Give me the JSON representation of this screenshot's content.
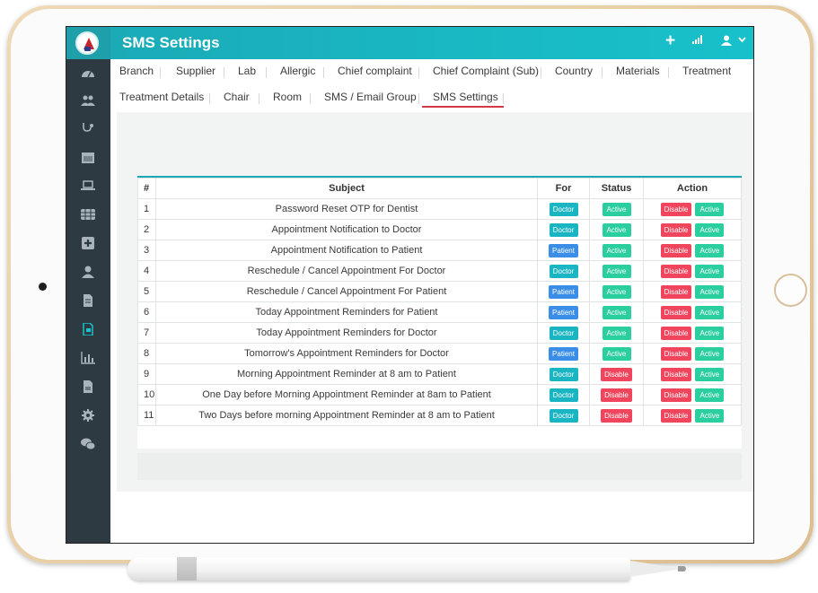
{
  "header": {
    "title": "SMS Settings"
  },
  "tabs": [
    "Branch",
    "Supplier",
    "Lab",
    "Allergic",
    "Chief complaint",
    "Chief Complaint (Sub)",
    "Country",
    "Materials",
    "Treatment",
    "Treatment Details",
    "Chair",
    "Room",
    "SMS / Email Group",
    "SMS Settings"
  ],
  "active_tab": "SMS Settings",
  "table": {
    "columns": [
      "#",
      "Subject",
      "For",
      "Status",
      "Action"
    ],
    "rows": [
      {
        "num": "1",
        "subject": "Password Reset OTP for Dentist",
        "for": "Doctor",
        "status": "Active",
        "action1": "Disable",
        "action2": "Active"
      },
      {
        "num": "2",
        "subject": "Appointment Notification to Doctor",
        "for": "Doctor",
        "status": "Active",
        "action1": "Disable",
        "action2": "Active"
      },
      {
        "num": "3",
        "subject": "Appointment Notification to Patient",
        "for": "Patient",
        "status": "Active",
        "action1": "Disable",
        "action2": "Active"
      },
      {
        "num": "4",
        "subject": "Reschedule / Cancel Appointment For Doctor",
        "for": "Doctor",
        "status": "Active",
        "action1": "Disable",
        "action2": "Active"
      },
      {
        "num": "5",
        "subject": "Reschedule / Cancel Appointment For Patient",
        "for": "Patient",
        "status": "Active",
        "action1": "Disable",
        "action2": "Active"
      },
      {
        "num": "6",
        "subject": "Today Appointment Reminders for Patient",
        "for": "Patient",
        "status": "Active",
        "action1": "Disable",
        "action2": "Active"
      },
      {
        "num": "7",
        "subject": "Today Appointment Reminders for Doctor",
        "for": "Doctor",
        "status": "Active",
        "action1": "Disable",
        "action2": "Active"
      },
      {
        "num": "8",
        "subject": "Tomorrow's Appointment Reminders for Doctor",
        "for": "Patient",
        "status": "Active",
        "action1": "Disable",
        "action2": "Active"
      },
      {
        "num": "9",
        "subject": "Morning Appointment Reminder at 8 am to Patient",
        "for": "Doctor",
        "status": "Disable",
        "action1": "Disable",
        "action2": "Active"
      },
      {
        "num": "10",
        "subject": "One Day before Morning Appointment Reminder at 8am to Patient",
        "for": "Doctor",
        "status": "Disable",
        "action1": "Disable",
        "action2": "Active"
      },
      {
        "num": "11",
        "subject": "Two Days before morning Appointment Reminder at 8 am to Patient",
        "for": "Doctor",
        "status": "Disable",
        "action1": "Disable",
        "action2": "Active"
      }
    ]
  },
  "sidebar_icons": [
    "dashboard-icon",
    "users-icon",
    "stethoscope-icon",
    "calendar-icon",
    "laptop-icon",
    "grid-icon",
    "medical-plus-icon",
    "user-icon",
    "document-icon",
    "sms-settings-icon",
    "bar-chart-icon",
    "report-icon",
    "gear-icon",
    "chat-icon"
  ],
  "colors": {
    "header": "#19b9c4",
    "sidebar": "#2d3a41",
    "active_tab_underline": "#d33a48",
    "doctor_badge": "#19b5c3",
    "patient_badge": "#3a8ee8",
    "active_badge": "#2bcf9f",
    "disable_badge": "#f0455d"
  }
}
